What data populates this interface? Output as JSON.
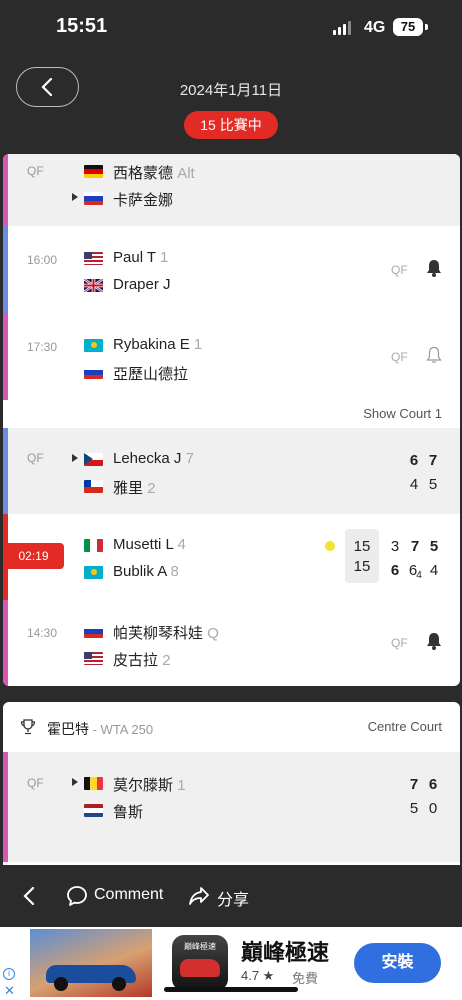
{
  "status": {
    "time": "15:51",
    "network": "4G",
    "battery": "75"
  },
  "header": {
    "date": "2024年1月11日",
    "live_label": "15 比賽中"
  },
  "matches_top": [
    {
      "stage": "QF",
      "p1": "西格蒙德",
      "p1_seed": "Alt",
      "p2": "卡萨金娜"
    },
    {
      "time": "16:00",
      "p1": "Paul T",
      "p1_seed": "1",
      "p2": "Draper J",
      "status": "QF"
    },
    {
      "time": "17:30",
      "p1": "Rybakina E",
      "p1_seed": "1",
      "p2": "亞歷山德拉",
      "status": "QF"
    }
  ],
  "court_show": "Show Court 1",
  "matches_mid": [
    {
      "stage": "QF",
      "p1": "Lehecka J",
      "p1_seed": "7",
      "p2": "雅里",
      "p2_seed": "2",
      "s1": [
        "6",
        "7"
      ],
      "s2": [
        "4",
        "5"
      ]
    },
    {
      "time": "02:19",
      "p1": "Musetti L",
      "p1_seed": "4",
      "p2": "Bublik A",
      "p2_seed": "8",
      "g1": "15",
      "g2": "15",
      "s1": [
        "3",
        "7",
        "5"
      ],
      "s2": [
        "6",
        "6",
        "4"
      ],
      "tb": "4"
    },
    {
      "time": "14:30",
      "p1": "帕芙柳琴科娃",
      "p1_seed": "Q",
      "p2": "皮古拉",
      "p2_seed": "2",
      "status": "QF"
    }
  ],
  "tournament": {
    "name": "霍巴特",
    "tier": " - WTA 250",
    "court": "Centre Court"
  },
  "match_bottom": {
    "stage": "QF",
    "p1": "莫尔滕斯",
    "p1_seed": "1",
    "p2": "鲁斯",
    "s1": [
      "7",
      "6"
    ],
    "s2": [
      "5",
      "0"
    ]
  },
  "bottombar": {
    "comment": "Comment",
    "share": "分享"
  },
  "ad": {
    "title": "巔峰極速",
    "rating": "4.7 ★",
    "price": "免費",
    "install": "安裝",
    "logo_text": "巔峰極速"
  },
  "colors": {
    "accent_red": "#e12b24",
    "wta_pink": "#d955b6",
    "atp_blue": "#6c8be0"
  }
}
